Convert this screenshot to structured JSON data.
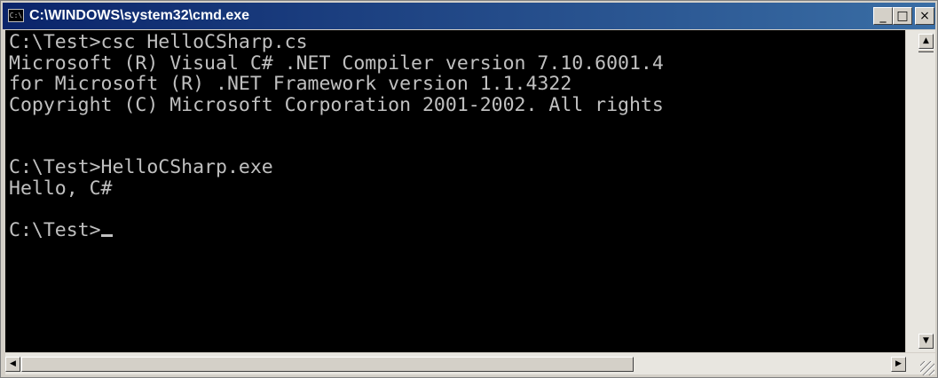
{
  "window": {
    "title": "C:\\WINDOWS\\system32\\cmd.exe",
    "icon_label": "C:\\",
    "minimize_label": "_",
    "maximize_label": "□",
    "close_label": "×"
  },
  "console": {
    "lines": [
      "C:\\Test>csc HelloCSharp.cs",
      "Microsoft (R) Visual C# .NET Compiler version 7.10.6001.4",
      "for Microsoft (R) .NET Framework version 1.1.4322",
      "Copyright (C) Microsoft Corporation 2001-2002. All rights",
      "",
      "",
      "C:\\Test>HelloCSharp.exe",
      "Hello, C#",
      "",
      "C:\\Test>"
    ]
  },
  "scrollbars": {
    "up_arrow": "▲",
    "down_arrow": "▼",
    "left_arrow": "◀",
    "right_arrow": "▶"
  },
  "colors": {
    "title_bar": "#0a246a",
    "console_bg": "#000000",
    "console_fg": "#c0c0c0"
  }
}
